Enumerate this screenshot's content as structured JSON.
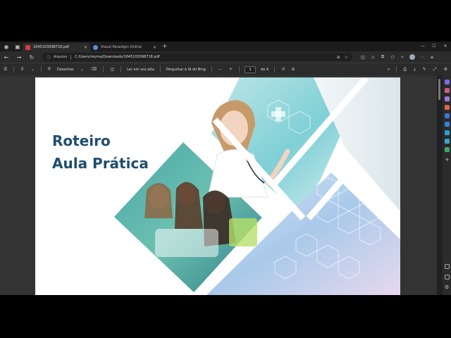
{
  "tabs": [
    {
      "label": "1645103098718.pdf",
      "active": true,
      "color": "#d93b3b"
    },
    {
      "label": "Visual Paradigm Online",
      "active": false,
      "color": "#5b8ed6"
    }
  ],
  "address": {
    "source_label": "Arquivo",
    "url": "C:/Users/reyma/Downloads/1645103098718.pdf"
  },
  "pdf_toolbar": {
    "draw_label": "Desenhar",
    "read_aloud_label": "Ler em voz alta",
    "ask_bing_label": "Perguntar à IA do Bing",
    "page_number": "1",
    "page_total": "de 4",
    "zoom_out": "−",
    "zoom_in": "+"
  },
  "document": {
    "title_line1": "Roteiro",
    "title_line2": "Aula Prática",
    "title_color": "#1f4e6e"
  },
  "icons": {
    "window_controls": [
      "minimize-icon",
      "maximize-icon",
      "close-icon"
    ],
    "nav": [
      "back-icon",
      "forward-icon",
      "refresh-icon"
    ]
  }
}
